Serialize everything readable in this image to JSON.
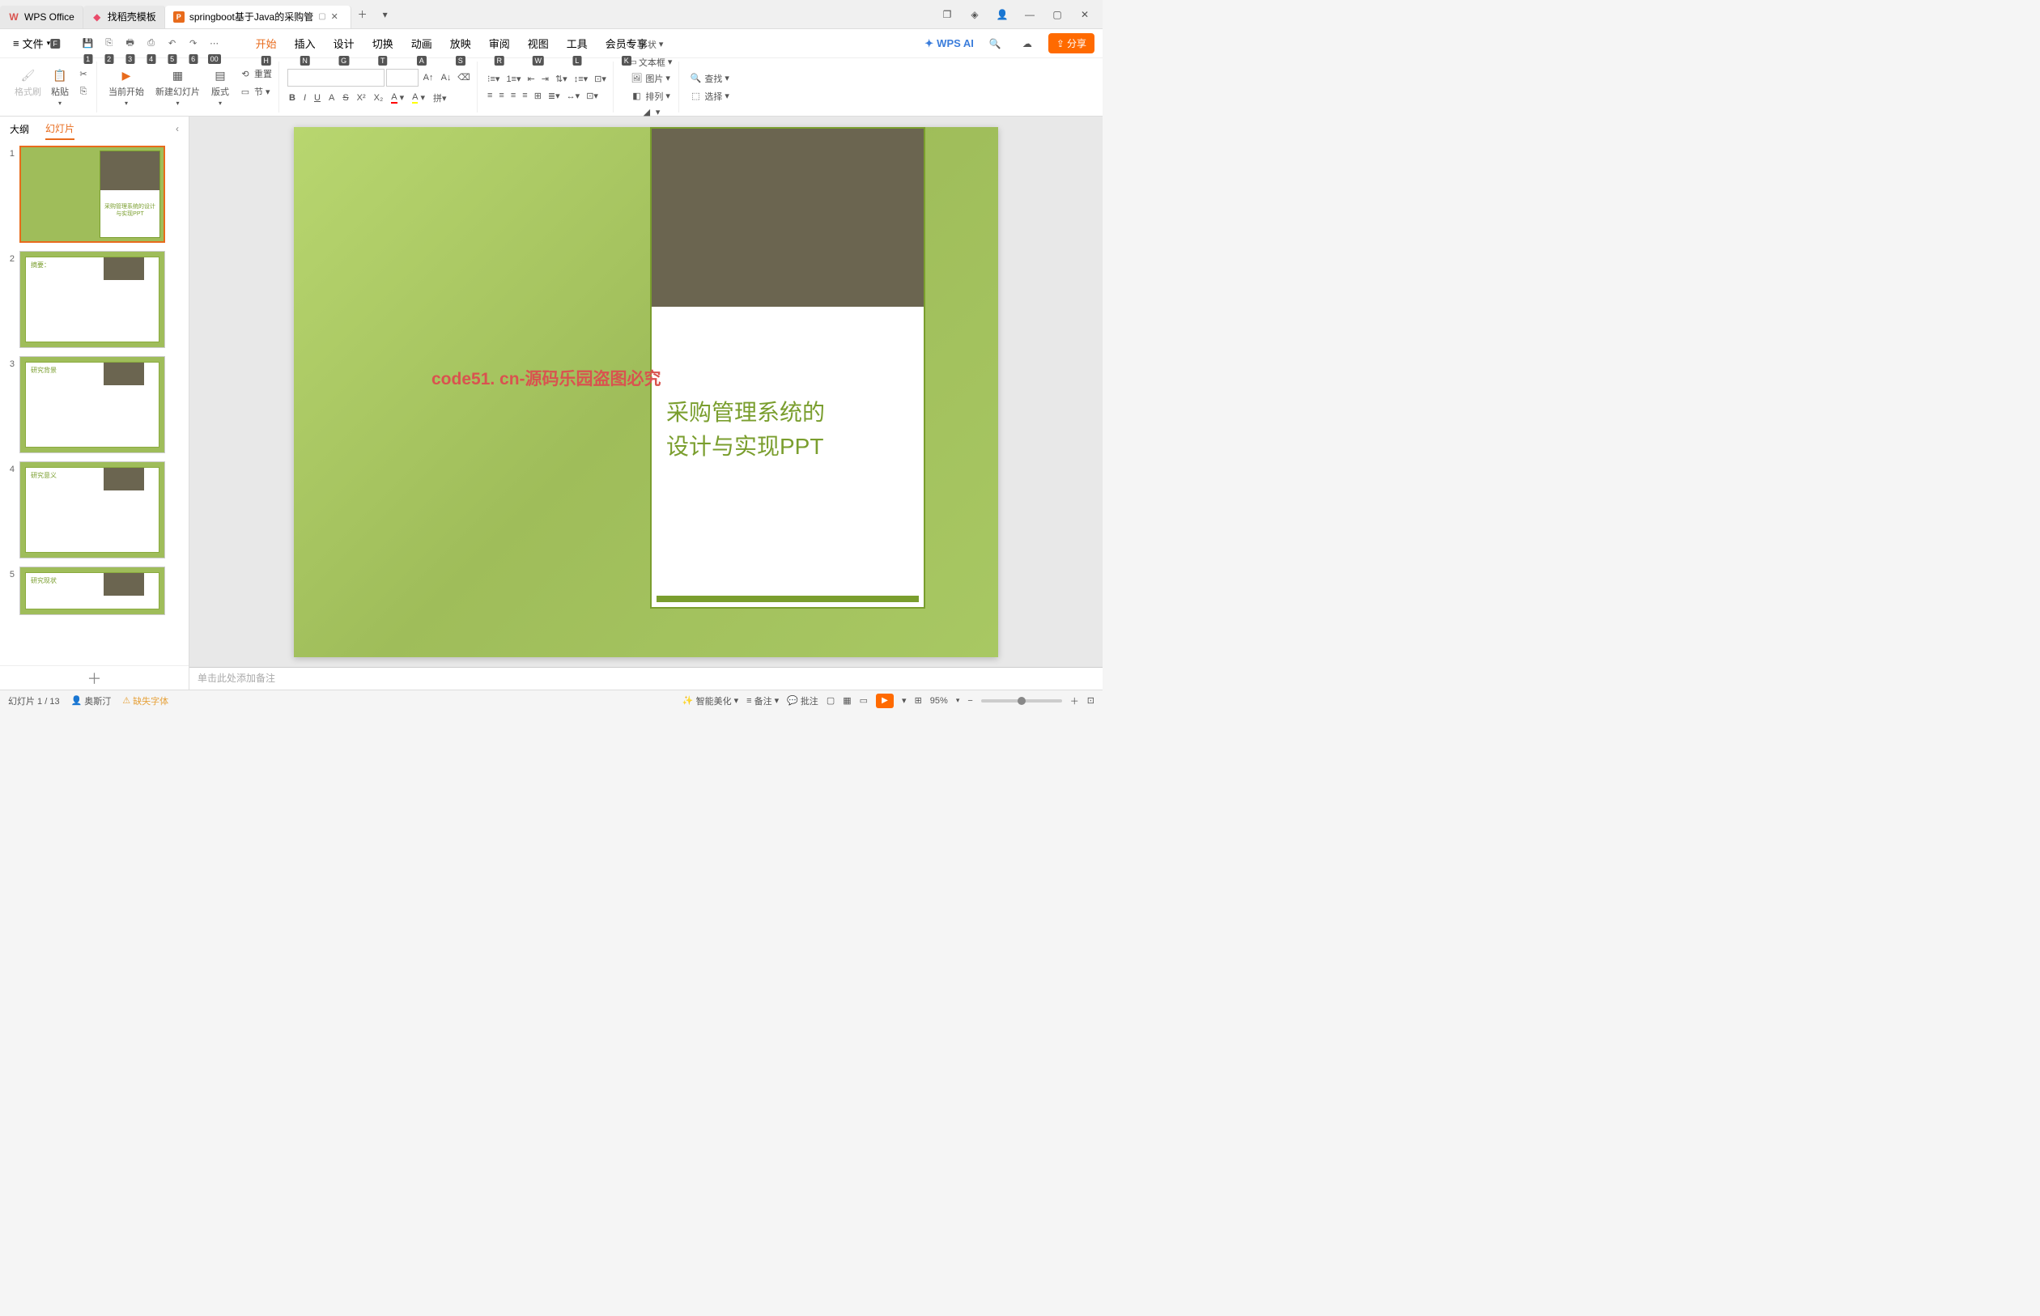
{
  "titlebar": {
    "tabs": [
      {
        "icon": "W",
        "iconColor": "#d9534f",
        "label": "WPS Office"
      },
      {
        "icon": "◆",
        "iconColor": "#e94b6a",
        "label": "找稻壳模板"
      },
      {
        "icon": "P",
        "iconColor": "#e86b1c",
        "label": "springboot基于Java的采购管",
        "active": true
      }
    ]
  },
  "menubar": {
    "file": "文件",
    "fileKbd": "F",
    "qat": [
      {
        "kbd": "1"
      },
      {
        "kbd": "2"
      },
      {
        "kbd": "3"
      },
      {
        "kbd": "4"
      },
      {
        "kbd": "5"
      },
      {
        "kbd": "6"
      },
      {
        "kbd": "00"
      }
    ],
    "tabs": [
      {
        "label": "开始",
        "kbd": "H",
        "active": true
      },
      {
        "label": "插入",
        "kbd": "N"
      },
      {
        "label": "设计",
        "kbd": "G"
      },
      {
        "label": "切换",
        "kbd": "T"
      },
      {
        "label": "动画",
        "kbd": "A"
      },
      {
        "label": "放映",
        "kbd": "S"
      },
      {
        "label": "审阅",
        "kbd": "R"
      },
      {
        "label": "视图",
        "kbd": "W"
      },
      {
        "label": "工具",
        "kbd": "L"
      },
      {
        "label": "会员专享",
        "kbd": "K"
      }
    ],
    "ai": "WPS AI",
    "share": "分享"
  },
  "ribbon": {
    "formatPainter": "格式刷",
    "paste": "粘贴",
    "fromCurrent": "当前开始",
    "newSlide": "新建幻灯片",
    "layout": "版式",
    "reset": "重置",
    "section": "节",
    "shape": "形状",
    "picture": "图片",
    "textbox": "文本框",
    "arrange": "排列",
    "find": "查找",
    "select": "选择"
  },
  "panel": {
    "outline": "大纲",
    "slides": "幻灯片",
    "thumbs": [
      {
        "num": "1",
        "title": "采购管理系统的设计与实现PPT",
        "type": "cover"
      },
      {
        "num": "2",
        "title": "摘要：",
        "type": "content"
      },
      {
        "num": "3",
        "title": "研究背景",
        "type": "content"
      },
      {
        "num": "4",
        "title": "研究意义",
        "type": "content"
      },
      {
        "num": "5",
        "title": "研究现状",
        "type": "content"
      }
    ]
  },
  "slide": {
    "titleLine1": "采购管理系统的",
    "titleLine2": "设计与实现PPT",
    "watermark": "code51. cn-源码乐园盗图必究"
  },
  "notes": "单击此处添加备注",
  "status": {
    "slideInfo": "幻灯片 1 / 13",
    "author": "奥斯汀",
    "missingFont": "缺失字体",
    "beautify": "智能美化",
    "remark": "备注",
    "review": "批注",
    "zoom": "95%"
  }
}
